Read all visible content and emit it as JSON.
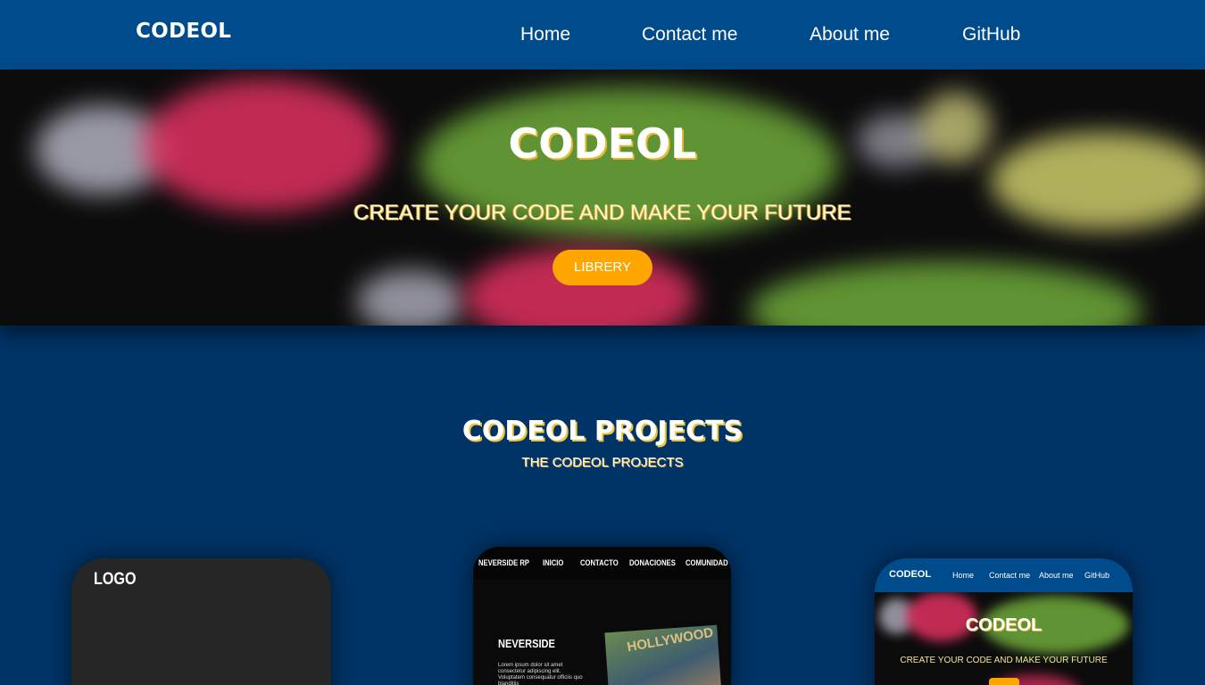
{
  "nav": {
    "brand": "CODEOL",
    "links": [
      "Home",
      "Contact me",
      "About me",
      "GitHub"
    ]
  },
  "hero": {
    "title": "CODEOL",
    "subtitle": "CREATE YOUR CODE AND MAKE YOUR FUTURE",
    "button_label": "LIBRERY"
  },
  "projects": {
    "title": "CODEOL PROJECTS",
    "subtitle": "THE CODEOL PROJECTS",
    "cards": [
      {
        "logo": "LOGO"
      },
      {
        "nav_links": [
          "NEVERSIDE RP",
          "INICIO",
          "CONTACTO",
          "DONACIONES",
          "COMUNIDAD"
        ],
        "heading": "NEVERSIDE",
        "body": "Lorem ipsum dolor sit amet consectetur adipiscing elit. Voluptatem consequatur officiis quo blanditiis",
        "image_text": "HOLLYWOOD"
      },
      {
        "brand": "CODEOL",
        "nav_links": [
          "Home",
          "Contact me",
          "About me",
          "GitHub"
        ],
        "title": "CODEOL",
        "subtitle": "CREATE YOUR CODE AND MAKE YOUR FUTURE"
      }
    ]
  },
  "colors": {
    "page_background": "#003366",
    "navbar": "#004b8c",
    "accent_button": "#ffa500",
    "title_shadow": "#e8b830"
  }
}
